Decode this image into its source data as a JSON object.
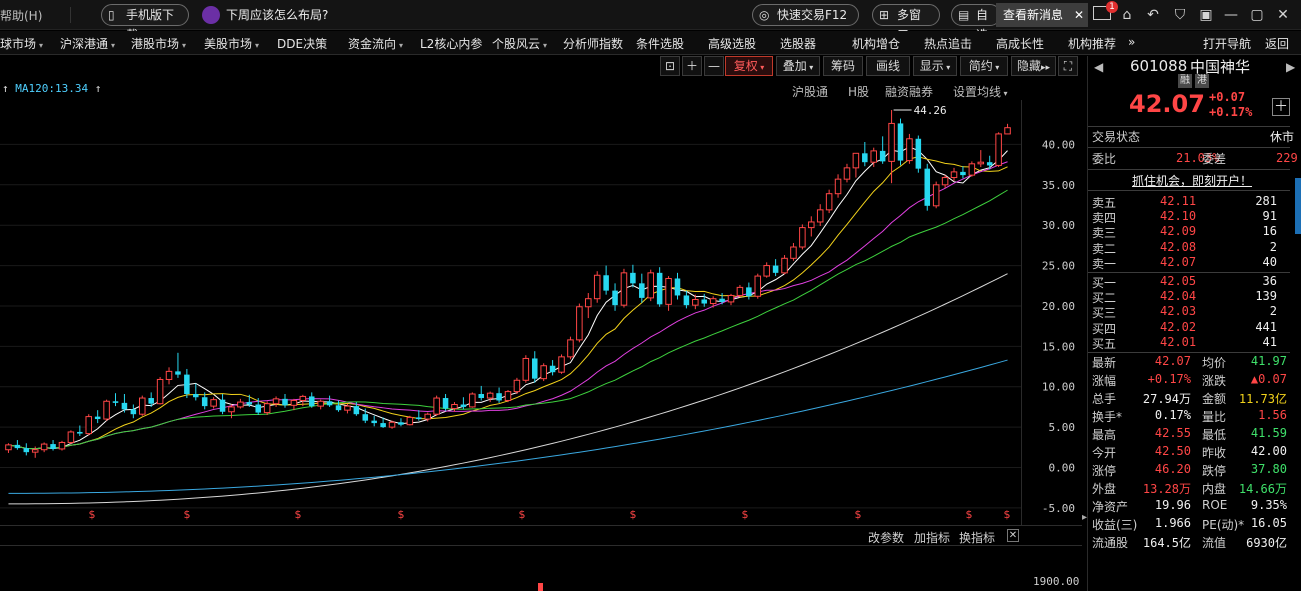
{
  "titlebar": {
    "help": "帮助(H)",
    "mobile_download": "手机版下载",
    "notice": "下周应该怎么布局?",
    "quick_trade": "快速交易F12",
    "multi_window": "多窗口",
    "self_select": "自选",
    "new_message": "查看新消息",
    "mail_badge": "1"
  },
  "nav": {
    "items": [
      {
        "label": "球市场",
        "arrow": true
      },
      {
        "label": "沪深港通",
        "arrow": true
      },
      {
        "label": "港股市场",
        "arrow": true
      },
      {
        "label": "美股市场",
        "arrow": true
      },
      {
        "label": "DDE决策",
        "arrow": false
      },
      {
        "label": "资金流向",
        "arrow": true
      },
      {
        "label": "L2核心内参",
        "arrow": false
      },
      {
        "label": "个股风云",
        "arrow": true
      },
      {
        "label": "分析师指数",
        "arrow": false
      },
      {
        "label": "条件选股",
        "arrow": false
      },
      {
        "label": "高级选股",
        "arrow": false
      },
      {
        "label": "选股器",
        "arrow": false
      },
      {
        "label": "机构增仓",
        "arrow": false
      },
      {
        "label": "热点追击",
        "arrow": false
      },
      {
        "label": "高成长性",
        "arrow": false
      },
      {
        "label": "机构推荐",
        "arrow": false
      }
    ],
    "more": "»",
    "open_nav": "打开导航",
    "back": "返回"
  },
  "chart_toolbar": {
    "fq": "复权",
    "overlay": "叠加",
    "chips": "筹码",
    "draw": "画线",
    "display": "显示",
    "simple": "简约",
    "hide": "隐藏"
  },
  "chart_info": {
    "ma120": "MA120:13.34"
  },
  "chart_subnav": {
    "hk_connect": "沪股通",
    "h_share": "H股",
    "margin": "融资融券",
    "set_ma": "设置均线"
  },
  "sub_bar": {
    "change_param": "改参数",
    "add_indicator": "加指标",
    "change_indicator": "换指标"
  },
  "volume_axis_label": "1900.00",
  "chart_data": {
    "type": "candlestick",
    "title": "",
    "yticks": [
      40.0,
      35.0,
      30.0,
      25.0,
      20.0,
      15.0,
      10.0,
      5.0,
      0.0,
      -5.0
    ],
    "ytick_labels": [
      "40.00",
      "35.00",
      "30.00",
      "25.00",
      "20.00",
      "15.00",
      "10.00",
      "5.00",
      "0.00",
      "-5.00"
    ],
    "ylim": [
      -6.5,
      45.5
    ],
    "high_label": "44.26",
    "ma120_value": 13.34,
    "candles": [
      [
        2.2,
        3.0,
        1.8,
        2.8
      ],
      [
        2.8,
        3.4,
        2.2,
        2.4
      ],
      [
        2.4,
        3.0,
        1.5,
        1.9
      ],
      [
        1.9,
        2.6,
        1.2,
        2.2
      ],
      [
        2.2,
        3.1,
        1.9,
        2.9
      ],
      [
        2.9,
        3.4,
        2.1,
        2.3
      ],
      [
        2.3,
        3.3,
        2.1,
        3.1
      ],
      [
        3.1,
        4.6,
        2.9,
        4.4
      ],
      [
        4.4,
        5.2,
        3.9,
        4.2
      ],
      [
        4.2,
        6.6,
        4.0,
        6.3
      ],
      [
        6.3,
        7.1,
        5.5,
        6.0
      ],
      [
        6.0,
        8.4,
        5.8,
        8.2
      ],
      [
        8.2,
        9.2,
        7.6,
        8.0
      ],
      [
        8.0,
        9.1,
        6.8,
        7.2
      ],
      [
        7.2,
        7.8,
        6.1,
        6.6
      ],
      [
        6.6,
        8.9,
        6.4,
        8.6
      ],
      [
        8.6,
        9.3,
        7.5,
        7.9
      ],
      [
        7.9,
        11.2,
        7.8,
        10.9
      ],
      [
        10.9,
        12.4,
        10.3,
        11.9
      ],
      [
        11.9,
        14.2,
        11.1,
        11.5
      ],
      [
        11.5,
        12.2,
        8.6,
        9.1
      ],
      [
        9.1,
        10.4,
        8.3,
        8.7
      ],
      [
        8.7,
        9.3,
        7.2,
        7.6
      ],
      [
        7.6,
        8.7,
        7.3,
        8.4
      ],
      [
        8.4,
        9.1,
        6.6,
        6.9
      ],
      [
        6.9,
        7.8,
        6.1,
        7.5
      ],
      [
        7.5,
        8.5,
        7.3,
        8.1
      ],
      [
        8.1,
        9.0,
        7.5,
        7.8
      ],
      [
        7.8,
        8.6,
        6.5,
        6.8
      ],
      [
        6.8,
        8.2,
        6.5,
        7.9
      ],
      [
        7.9,
        8.8,
        7.5,
        8.5
      ],
      [
        8.5,
        9.1,
        7.4,
        7.7
      ],
      [
        7.7,
        8.5,
        7.1,
        8.3
      ],
      [
        8.3,
        9.0,
        7.6,
        8.8
      ],
      [
        8.8,
        9.3,
        7.4,
        7.6
      ],
      [
        7.6,
        8.4,
        7.2,
        8.2
      ],
      [
        8.2,
        8.9,
        7.5,
        7.7
      ],
      [
        7.7,
        8.3,
        6.9,
        7.1
      ],
      [
        7.1,
        7.9,
        6.7,
        7.6
      ],
      [
        7.6,
        8.1,
        6.4,
        6.6
      ],
      [
        6.6,
        7.3,
        5.5,
        5.8
      ],
      [
        5.8,
        6.4,
        5.1,
        5.5
      ],
      [
        5.5,
        6.2,
        4.9,
        5.0
      ],
      [
        5.0,
        5.8,
        4.8,
        5.6
      ],
      [
        5.6,
        6.1,
        5.1,
        5.3
      ],
      [
        5.3,
        6.4,
        5.2,
        6.2
      ],
      [
        6.2,
        7.1,
        5.8,
        6.0
      ],
      [
        6.0,
        6.8,
        5.7,
        6.6
      ],
      [
        6.6,
        8.9,
        6.4,
        8.6
      ],
      [
        8.6,
        9.1,
        7.0,
        7.3
      ],
      [
        7.3,
        8.1,
        6.9,
        7.8
      ],
      [
        7.8,
        8.7,
        7.2,
        7.5
      ],
      [
        7.5,
        9.3,
        7.4,
        9.1
      ],
      [
        9.1,
        10.1,
        8.3,
        8.6
      ],
      [
        8.6,
        9.4,
        8.1,
        9.2
      ],
      [
        9.2,
        9.9,
        8.0,
        8.3
      ],
      [
        8.3,
        9.6,
        8.1,
        9.4
      ],
      [
        9.4,
        11.1,
        9.1,
        10.8
      ],
      [
        10.8,
        13.9,
        10.5,
        13.5
      ],
      [
        13.5,
        14.4,
        10.5,
        11.0
      ],
      [
        11.0,
        12.9,
        10.7,
        12.6
      ],
      [
        12.6,
        13.3,
        11.4,
        11.8
      ],
      [
        11.8,
        14.0,
        11.6,
        13.7
      ],
      [
        13.7,
        16.2,
        13.4,
        15.8
      ],
      [
        15.8,
        20.3,
        15.5,
        19.9
      ],
      [
        19.9,
        21.6,
        18.5,
        20.9
      ],
      [
        20.9,
        24.3,
        20.4,
        23.8
      ],
      [
        23.8,
        25.0,
        21.4,
        21.9
      ],
      [
        21.9,
        22.8,
        19.4,
        20.1
      ],
      [
        20.1,
        24.6,
        19.8,
        24.1
      ],
      [
        24.1,
        25.1,
        22.3,
        22.8
      ],
      [
        22.8,
        24.0,
        20.4,
        21.0
      ],
      [
        21.0,
        24.5,
        20.6,
        24.1
      ],
      [
        24.1,
        24.8,
        19.9,
        20.2
      ],
      [
        20.2,
        23.7,
        19.4,
        23.4
      ],
      [
        23.4,
        24.1,
        20.8,
        21.3
      ],
      [
        21.3,
        21.9,
        19.7,
        20.1
      ],
      [
        20.1,
        21.4,
        19.6,
        20.8
      ],
      [
        20.8,
        21.5,
        19.9,
        20.3
      ],
      [
        20.3,
        21.2,
        19.8,
        20.9
      ],
      [
        20.9,
        21.6,
        20.2,
        20.5
      ],
      [
        20.5,
        21.5,
        20.1,
        21.3
      ],
      [
        21.3,
        22.6,
        21.1,
        22.3
      ],
      [
        22.3,
        22.9,
        20.8,
        21.2
      ],
      [
        21.2,
        24.0,
        20.9,
        23.7
      ],
      [
        23.7,
        25.4,
        23.5,
        25.0
      ],
      [
        25.0,
        25.8,
        23.7,
        24.1
      ],
      [
        24.1,
        26.3,
        23.9,
        25.9
      ],
      [
        25.9,
        27.8,
        25.6,
        27.3
      ],
      [
        27.3,
        30.1,
        27.0,
        29.7
      ],
      [
        29.7,
        31.1,
        28.6,
        30.4
      ],
      [
        30.4,
        32.6,
        29.9,
        31.9
      ],
      [
        31.9,
        34.4,
        31.5,
        33.9
      ],
      [
        33.9,
        36.3,
        33.4,
        35.7
      ],
      [
        35.7,
        37.6,
        35.3,
        37.1
      ],
      [
        37.1,
        38.4,
        35.9,
        38.9
      ],
      [
        38.9,
        40.3,
        37.3,
        37.8
      ],
      [
        37.8,
        39.6,
        37.2,
        39.2
      ],
      [
        39.2,
        41.0,
        37.6,
        37.9
      ],
      [
        37.9,
        44.26,
        35.2,
        42.6
      ],
      [
        42.6,
        43.2,
        37.4,
        38.0
      ],
      [
        38.0,
        41.3,
        37.6,
        40.7
      ],
      [
        40.7,
        41.1,
        36.5,
        37.0
      ],
      [
        37.0,
        37.6,
        31.8,
        32.4
      ],
      [
        32.4,
        35.4,
        32.1,
        35.0
      ],
      [
        35.0,
        36.2,
        34.6,
        35.9
      ],
      [
        35.9,
        37.1,
        35.5,
        36.6
      ],
      [
        36.6,
        37.3,
        35.8,
        36.2
      ],
      [
        36.2,
        37.9,
        36.0,
        37.6
      ],
      [
        37.6,
        39.3,
        37.2,
        37.8
      ],
      [
        37.8,
        38.6,
        36.9,
        37.4
      ],
      [
        37.4,
        41.5,
        37.2,
        41.3
      ],
      [
        41.3,
        42.55,
        41.59,
        42.07
      ]
    ]
  },
  "right_panel": {
    "code": "601088",
    "name": "中国神华",
    "tag_rong": "融",
    "tag_gang": "港",
    "price": "42.07",
    "change": "+0.07",
    "change_pct": "+0.17%",
    "trade_status_label": "交易状态",
    "trade_status": "休市",
    "weibi_label": "委比",
    "weibi": "21.03%",
    "weicha_label": "委差",
    "weicha": "229",
    "promo": "抓住机会，即刻开户！",
    "asks": [
      {
        "label": "卖五",
        "price": "42.11",
        "vol": "281"
      },
      {
        "label": "卖四",
        "price": "42.10",
        "vol": "91"
      },
      {
        "label": "卖三",
        "price": "42.09",
        "vol": "16"
      },
      {
        "label": "卖二",
        "price": "42.08",
        "vol": "2"
      },
      {
        "label": "卖一",
        "price": "42.07",
        "vol": "40"
      }
    ],
    "bids": [
      {
        "label": "买一",
        "price": "42.05",
        "vol": "36"
      },
      {
        "label": "买二",
        "price": "42.04",
        "vol": "139"
      },
      {
        "label": "买三",
        "price": "42.03",
        "vol": "2"
      },
      {
        "label": "买四",
        "price": "42.02",
        "vol": "441"
      },
      {
        "label": "买五",
        "price": "42.01",
        "vol": "41"
      }
    ],
    "stats": [
      {
        "l1": "最新",
        "v1": "42.07",
        "c1": "red",
        "l2": "均价",
        "v2": "41.97",
        "c2": "green"
      },
      {
        "l1": "涨幅",
        "v1": "+0.17%",
        "c1": "red",
        "l2": "涨跌",
        "v2": "▲0.07",
        "c2": "red"
      },
      {
        "l1": "总手",
        "v1": "27.94万",
        "c1": "white",
        "l2": "金额",
        "v2": "11.73亿",
        "c2": "yellow"
      },
      {
        "l1": "换手*",
        "v1": "0.17%",
        "c1": "white",
        "l2": "量比",
        "v2": "1.56",
        "c2": "red"
      },
      {
        "l1": "最高",
        "v1": "42.55",
        "c1": "red",
        "l2": "最低",
        "v2": "41.59",
        "c2": "green"
      },
      {
        "l1": "今开",
        "v1": "42.50",
        "c1": "red",
        "l2": "昨收",
        "v2": "42.00",
        "c2": "white"
      },
      {
        "l1": "涨停",
        "v1": "46.20",
        "c1": "red",
        "l2": "跌停",
        "v2": "37.80",
        "c2": "green"
      },
      {
        "l1": "外盘",
        "v1": "13.28万",
        "c1": "red",
        "l2": "内盘",
        "v2": "14.66万",
        "c2": "green"
      },
      {
        "l1": "净资产",
        "v1": "19.96",
        "c1": "white",
        "l2": "ROE",
        "v2": "9.35%",
        "c2": "white"
      },
      {
        "l1": "收益(三)",
        "v1": "1.966",
        "c1": "white",
        "l2": "PE(动)*",
        "v2": "16.05",
        "c2": "white"
      },
      {
        "l1": "流通股",
        "v1": "164.5亿",
        "c1": "white",
        "l2": "流值",
        "v2": "6930亿",
        "c2": "white"
      }
    ]
  },
  "colors": {
    "up": "#ff4646",
    "down": "#27d8f0",
    "ma5": "#ffffff",
    "ma10": "#f2d21b",
    "ma20": "#e040e0",
    "ma30": "#3ed03e",
    "ma60": "#d8d8d8",
    "ma120": "#3aa8e0"
  }
}
